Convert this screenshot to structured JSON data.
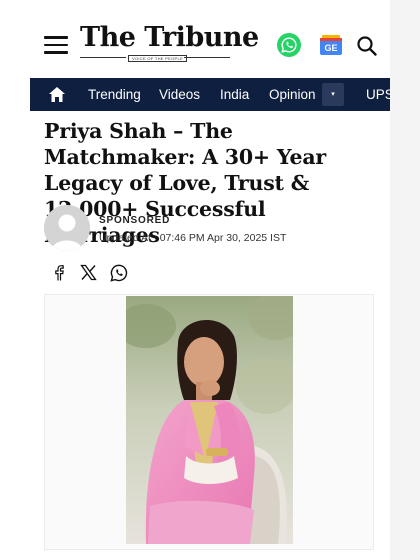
{
  "header": {
    "logo_text": "The Tribune",
    "logo_tagline": "VOICE OF THE PEOPLE",
    "icons": {
      "menu": "hamburger-menu-icon",
      "whatsapp": "whatsapp-icon",
      "google_news": "google-news-icon",
      "google_news_label": "GE",
      "search": "search-icon"
    }
  },
  "nav": {
    "home_icon": "home-icon",
    "items": [
      "Trending",
      "Videos",
      "India",
      "Opinion",
      "UPS"
    ],
    "more_label": "▾",
    "background": "#0e1f40"
  },
  "article": {
    "title": "Priya Shah – The Matchmaker: A 30+ Year Legacy of Love, Trust & 12,000+ Successful Marriages",
    "sponsored_label": "SPONSORED",
    "updated": "Updated At : 07:46 PM Apr 30, 2025 IST",
    "share_icons": [
      "facebook-icon",
      "x-icon",
      "whatsapp-icon"
    ]
  },
  "colors": {
    "nav_bg": "#0e1f40",
    "whatsapp_green": "#25d366",
    "text": "#111111"
  }
}
